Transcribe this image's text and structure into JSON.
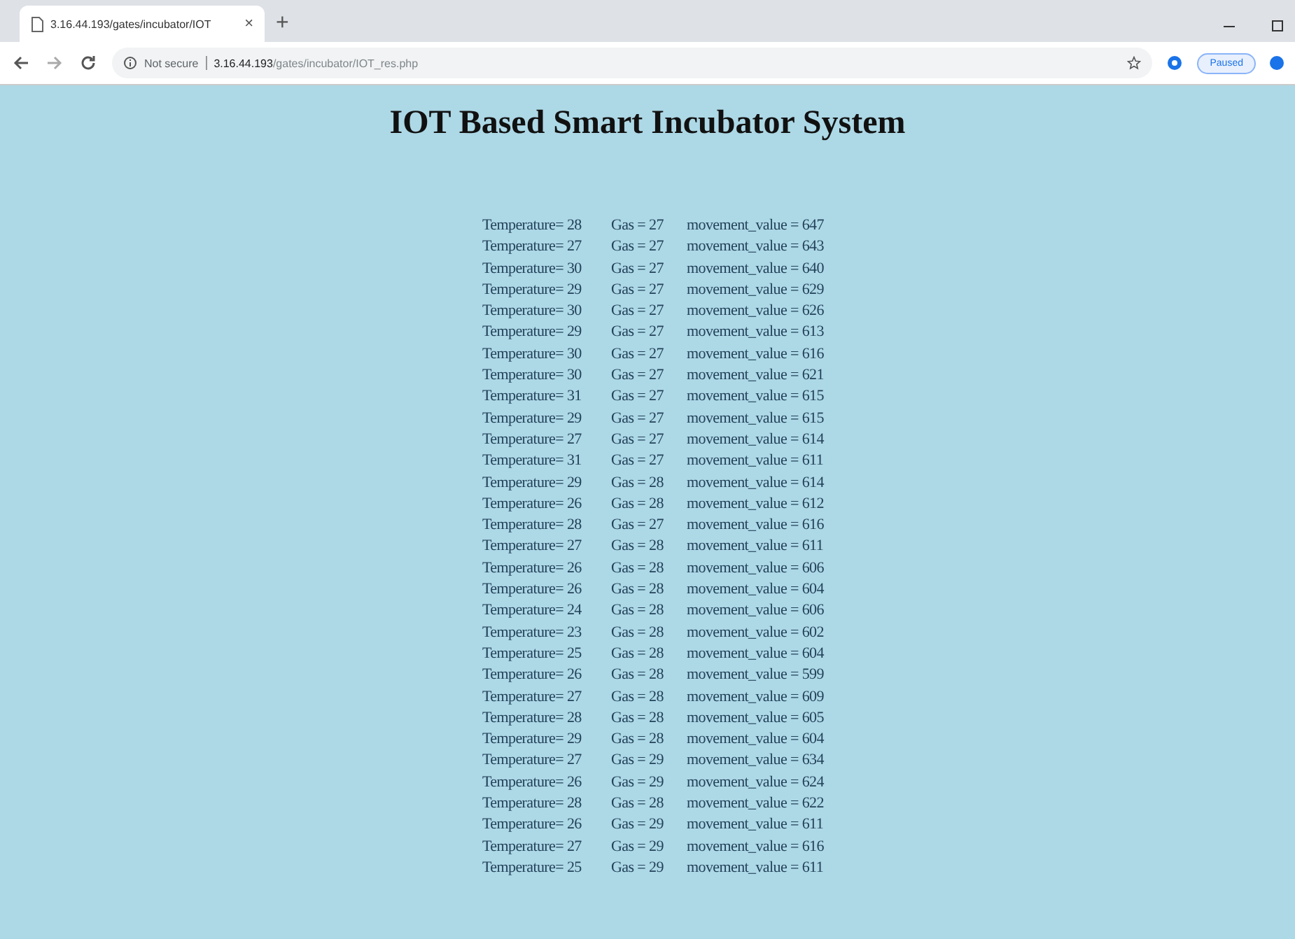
{
  "browser": {
    "tab_title": "3.16.44.193/gates/incubator/IOT",
    "tab_close": "×",
    "new_tab": "+",
    "security": "Not secure",
    "url_host": "3.16.44.193",
    "url_path": "/gates/incubator/IOT_res.php",
    "profile": "Paused"
  },
  "page": {
    "title": "IOT Based Smart Incubator System",
    "rows": [
      {
        "temperature": "Temperature= 28",
        "gas": "Gas = 27",
        "movement": "movement_value = 647"
      },
      {
        "temperature": "Temperature= 27",
        "gas": "Gas = 27",
        "movement": "movement_value = 643"
      },
      {
        "temperature": "Temperature= 30",
        "gas": "Gas = 27",
        "movement": "movement_value = 640"
      },
      {
        "temperature": "Temperature= 29",
        "gas": "Gas = 27",
        "movement": "movement_value = 629"
      },
      {
        "temperature": "Temperature= 30",
        "gas": "Gas = 27",
        "movement": "movement_value = 626"
      },
      {
        "temperature": "Temperature= 29",
        "gas": "Gas = 27",
        "movement": "movement_value = 613"
      },
      {
        "temperature": "Temperature= 30",
        "gas": "Gas = 27",
        "movement": "movement_value = 616"
      },
      {
        "temperature": "Temperature= 30",
        "gas": "Gas = 27",
        "movement": "movement_value = 621"
      },
      {
        "temperature": "Temperature= 31",
        "gas": "Gas = 27",
        "movement": "movement_value = 615"
      },
      {
        "temperature": "Temperature= 29",
        "gas": "Gas = 27",
        "movement": "movement_value = 615"
      },
      {
        "temperature": "Temperature= 27",
        "gas": "Gas = 27",
        "movement": "movement_value = 614"
      },
      {
        "temperature": "Temperature= 31",
        "gas": "Gas = 27",
        "movement": "movement_value = 611"
      },
      {
        "temperature": "Temperature= 29",
        "gas": "Gas = 28",
        "movement": "movement_value = 614"
      },
      {
        "temperature": "Temperature= 26",
        "gas": "Gas = 28",
        "movement": "movement_value = 612"
      },
      {
        "temperature": "Temperature= 28",
        "gas": "Gas = 27",
        "movement": "movement_value = 616"
      },
      {
        "temperature": "Temperature= 27",
        "gas": "Gas = 28",
        "movement": "movement_value = 611"
      },
      {
        "temperature": "Temperature= 26",
        "gas": "Gas = 28",
        "movement": "movement_value = 606"
      },
      {
        "temperature": "Temperature= 26",
        "gas": "Gas = 28",
        "movement": "movement_value = 604"
      },
      {
        "temperature": "Temperature= 24",
        "gas": "Gas = 28",
        "movement": "movement_value = 606"
      },
      {
        "temperature": "Temperature= 23",
        "gas": "Gas = 28",
        "movement": "movement_value = 602"
      },
      {
        "temperature": "Temperature= 25",
        "gas": "Gas = 28",
        "movement": "movement_value = 604"
      },
      {
        "temperature": "Temperature= 26",
        "gas": "Gas = 28",
        "movement": "movement_value = 599"
      },
      {
        "temperature": "Temperature= 27",
        "gas": "Gas = 28",
        "movement": "movement_value = 609"
      },
      {
        "temperature": "Temperature= 28",
        "gas": "Gas = 28",
        "movement": "movement_value = 605"
      },
      {
        "temperature": "Temperature= 29",
        "gas": "Gas = 28",
        "movement": "movement_value = 604"
      },
      {
        "temperature": "Temperature= 27",
        "gas": "Gas = 29",
        "movement": "movement_value = 634"
      },
      {
        "temperature": "Temperature= 26",
        "gas": "Gas = 29",
        "movement": "movement_value = 624"
      },
      {
        "temperature": "Temperature= 28",
        "gas": "Gas = 28",
        "movement": "movement_value = 622"
      },
      {
        "temperature": "Temperature= 26",
        "gas": "Gas = 29",
        "movement": "movement_value = 611"
      },
      {
        "temperature": "Temperature= 27",
        "gas": "Gas = 29",
        "movement": "movement_value = 616"
      },
      {
        "temperature": "Temperature= 25",
        "gas": "Gas = 29",
        "movement": "movement_value = 611"
      }
    ]
  }
}
